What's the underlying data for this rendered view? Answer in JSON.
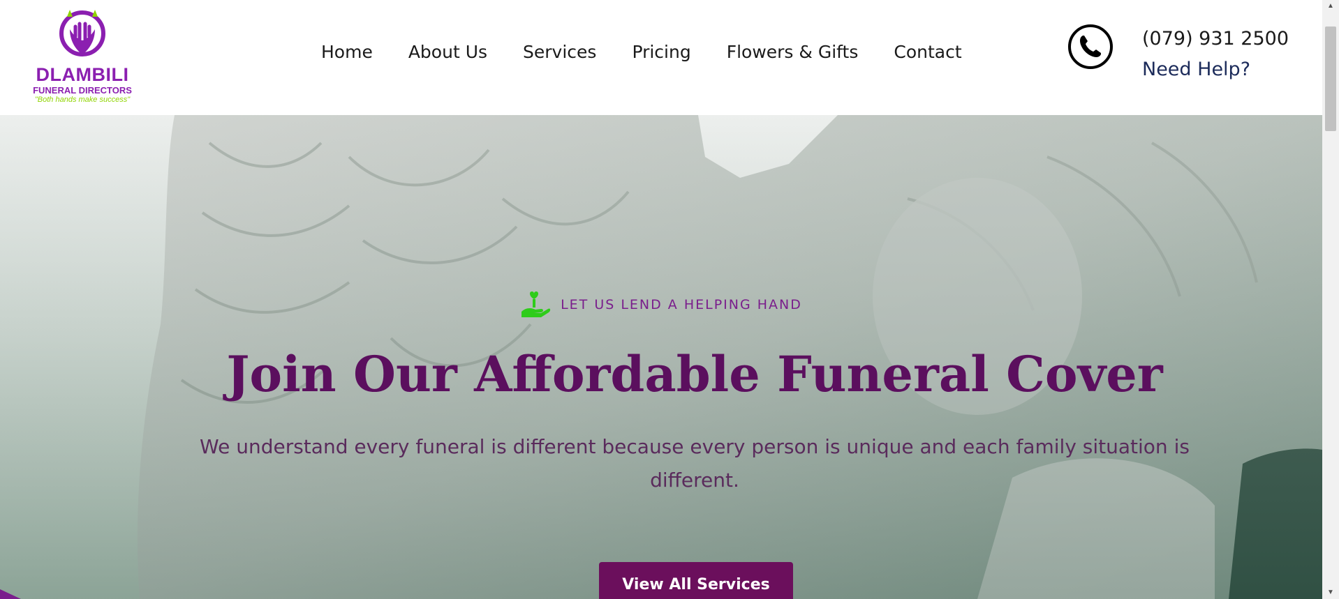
{
  "brand": {
    "name": "DLAMBILI",
    "subtitle": "FUNERAL DIRECTORS",
    "tagline": "\"Both hands make success\""
  },
  "nav": {
    "items": [
      {
        "label": "Home"
      },
      {
        "label": "About Us"
      },
      {
        "label": "Services"
      },
      {
        "label": "Pricing"
      },
      {
        "label": "Flowers & Gifts"
      },
      {
        "label": "Contact"
      }
    ]
  },
  "contact": {
    "phone": "(079) 931 2500",
    "help": "Need Help?",
    "icon": "phone-icon"
  },
  "hero": {
    "tagline": "LET US LEND A HELPING HAND",
    "tagline_icon": "helping-hand-icon",
    "title": "Join Our Affordable Funeral Cover",
    "text": "We understand every funeral is different because every person is unique and each family situation is different.",
    "cta": "View All Services"
  },
  "colors": {
    "brand_purple": "#8b1fb0",
    "title_purple": "#5b0f5e",
    "button_bg": "#6b0f5c",
    "accent_green": "#2ecc1a"
  }
}
